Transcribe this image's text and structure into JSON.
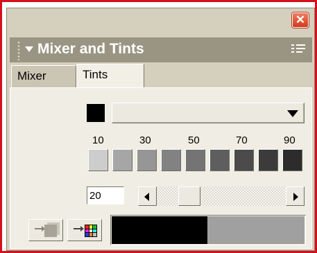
{
  "window": {
    "close_icon": "close-icon",
    "close_glyph": "✕"
  },
  "panel": {
    "title": "Mixer and Tints",
    "options_icon": "options-menu-icon",
    "collapse_icon": "triangle-down-icon"
  },
  "tabs": [
    {
      "label": "Mixer",
      "active": false
    },
    {
      "label": "Tints",
      "active": true
    }
  ],
  "base_color": {
    "swatch": "#000000",
    "selector_icon": "dropdown-arrow-icon"
  },
  "tint_scale_labels": [
    "10",
    "30",
    "50",
    "70",
    "90"
  ],
  "tint_swatches": [
    "#cdcdcd",
    "#a6a6a6",
    "#969696",
    "#828282",
    "#747474",
    "#5e5e5e",
    "#4b4b4b",
    "#3b3b3b",
    "#2c2c2c"
  ],
  "tint_value": "20",
  "slider": {
    "value_percent": 20
  },
  "buttons": {
    "apply_icon": "apply-tint-icon",
    "add_to_swatches_icon": "add-to-swatches-icon"
  },
  "preview": {
    "base": "#000000",
    "tint": "#a0a0a0"
  },
  "colors": {
    "frame_border": "#d4101a",
    "panel_bg": "#d5cfbd",
    "title_bar": "#9a9583",
    "content_bg": "#efede4"
  }
}
